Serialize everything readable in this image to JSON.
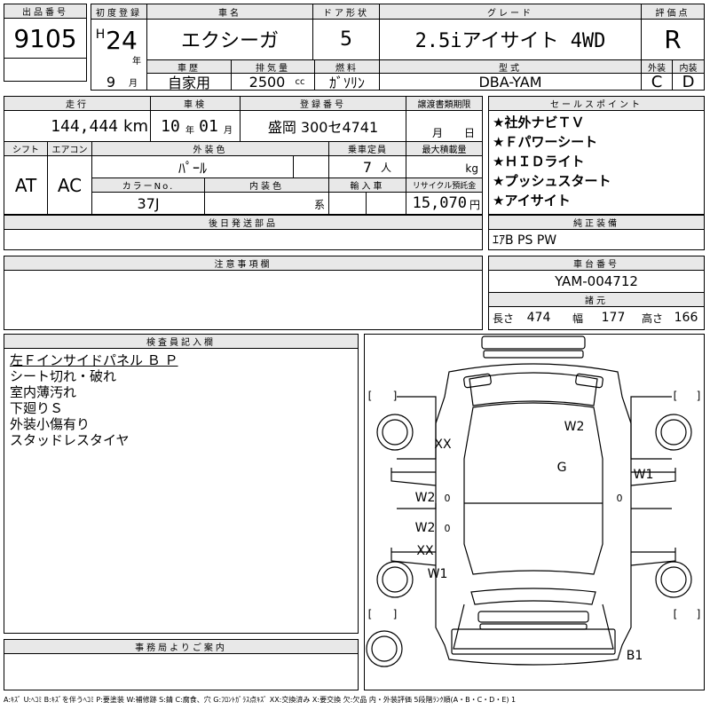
{
  "header": {
    "lot_label": "出品番号",
    "lot_value": "9105",
    "first_reg_label": "初度登録",
    "era": "H",
    "year": "24",
    "year_unit": "年",
    "month": "9",
    "month_unit": "月",
    "name_label": "車名",
    "name_value": "エクシーガ",
    "door_label": "ドア形状",
    "door_value": "5",
    "grade_label": "グレード",
    "grade_value": "2.5iアイサイト 4WD",
    "score_label": "評価点",
    "score_value": "R",
    "history_label": "車歴",
    "history_value": "自家用",
    "displacement_label": "排気量",
    "displacement_value": "2500",
    "displacement_unit": "cc",
    "fuel_label": "燃料",
    "fuel_value": "ｶﾞｿﾘﾝ",
    "model_label": "型式",
    "model_value": "DBA-YAM",
    "exterior_label": "外装",
    "exterior_value": "C",
    "interior_label": "内装",
    "interior_value": "D"
  },
  "row2": {
    "mileage_label": "走行",
    "mileage_value": "144,444",
    "mileage_unit": "km",
    "inspection_label": "車検",
    "inspection_year": "10",
    "inspection_year_unit": "年",
    "inspection_month": "01",
    "inspection_month_unit": "月",
    "reg_label": "登録番号",
    "reg_value": "盛岡 300セ4741",
    "transfer_label": "譲渡書類期限",
    "transfer_month_unit": "月",
    "transfer_day_unit": "日",
    "shift_label": "シフト",
    "shift_value": "AT",
    "aircon_label": "エアコン",
    "aircon_value": "AC",
    "color_label": "外装色",
    "color_value": "ﾊﾟｰﾙ",
    "capacity_label": "乗車定員",
    "capacity_value": "7",
    "capacity_unit": "人",
    "load_label": "最大積載量",
    "load_unit": "kg",
    "colorno_label": "カラーNo.",
    "colorno_value": "37J",
    "intcolor_label": "内装色",
    "intcolor_unit": "系",
    "import_label": "輸入車",
    "recycle_label": "リサイクル預託金",
    "recycle_value": "15,070",
    "recycle_unit": "円"
  },
  "sales": {
    "label": "セールスポイント",
    "points": [
      "★社外ナビＴＶ",
      "★Ｆパワーシート",
      "★ＨＩＤライト",
      "★プッシュスタート",
      "★アイサイト"
    ]
  },
  "later_parts": {
    "label": "後日発送部品"
  },
  "equipment": {
    "label": "純正装備",
    "value": "ｴｱB PS PW"
  },
  "notes": {
    "label": "注意事項欄"
  },
  "chassis": {
    "label": "車台番号",
    "value": "YAM-004712"
  },
  "specs": {
    "label": "諸元",
    "length_label": "長さ",
    "length_value": "474",
    "width_label": "幅",
    "width_value": "177",
    "height_label": "高さ",
    "height_value": "166"
  },
  "inspector": {
    "label": "検査員記入欄",
    "lines": [
      "左Ｆインサイドパネル Ｂ Ｐ",
      "シート切れ・破れ",
      "室内薄汚れ",
      "下廻りＳ",
      "外装小傷有り",
      "スタッドレスタイヤ"
    ]
  },
  "office": {
    "label": "事務局よりご案内"
  },
  "diagram": {
    "marks": [
      "W2",
      "XX",
      "G",
      "W1",
      "W2",
      "W2",
      "XX",
      "W1",
      "B1"
    ],
    "zeros": [
      "0",
      "0",
      "0"
    ],
    "brackets": [
      "[",
      "]",
      "[",
      "]",
      "[",
      "]",
      "[",
      "]"
    ]
  },
  "legend": "A:ｷｽﾞ U:ﾍｺﾐ B:ｷｽﾞを伴うﾍｺﾐ P:要塗装 W:補修跡 S:錆 C:腐食、穴 G:ﾌﾛﾝﾄｶﾞﾗｽ点ｷｽﾞ XX:交換済み X:要交換 欠:欠品 内・外装評価 5段階ﾗﾝｸ順(A・B・C・D・E) 1"
}
